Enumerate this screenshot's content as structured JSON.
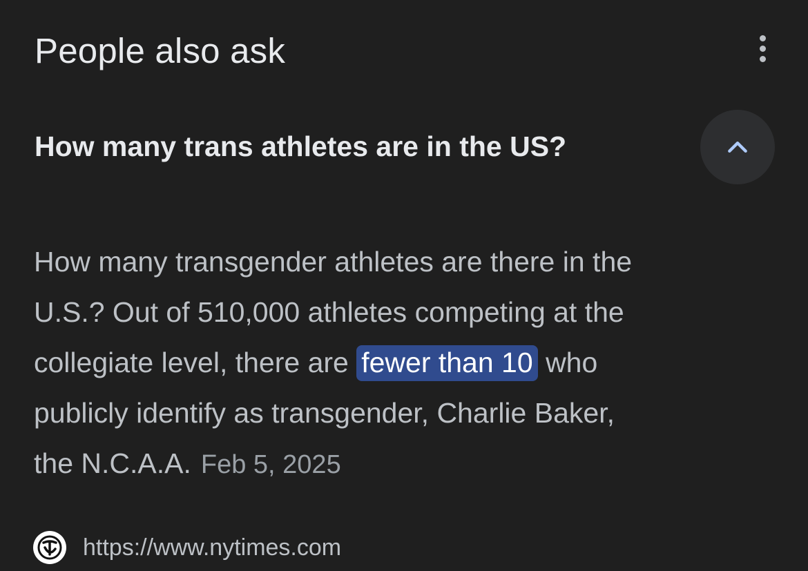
{
  "header": {
    "title": "People also ask",
    "more_icon": "more-vert-icon"
  },
  "question": {
    "text": "How many trans athletes are in the US?",
    "toggle_icon": "chevron-up-icon",
    "expanded": true
  },
  "answer": {
    "line1": "How many transgender athletes are there in the",
    "line2": "U.S.? Out of 510,000 athletes competing at the",
    "line3_before": "collegiate level, there are ",
    "highlight": "fewer than 10",
    "line3_after": " who",
    "line4": "publicly identify as transgender, Charlie Baker,",
    "line5": "the N.C.A.A.",
    "date": "Feb 5, 2025"
  },
  "source": {
    "favicon_icon": "nytimes-logo-icon",
    "url": "https://www.nytimes.com"
  },
  "colors": {
    "background": "#1f1f1f",
    "text_primary": "#e8eaed",
    "text_secondary": "#bdc1c6",
    "highlight_bg": "#304b8e",
    "toggle_bg": "#2d2e30"
  }
}
